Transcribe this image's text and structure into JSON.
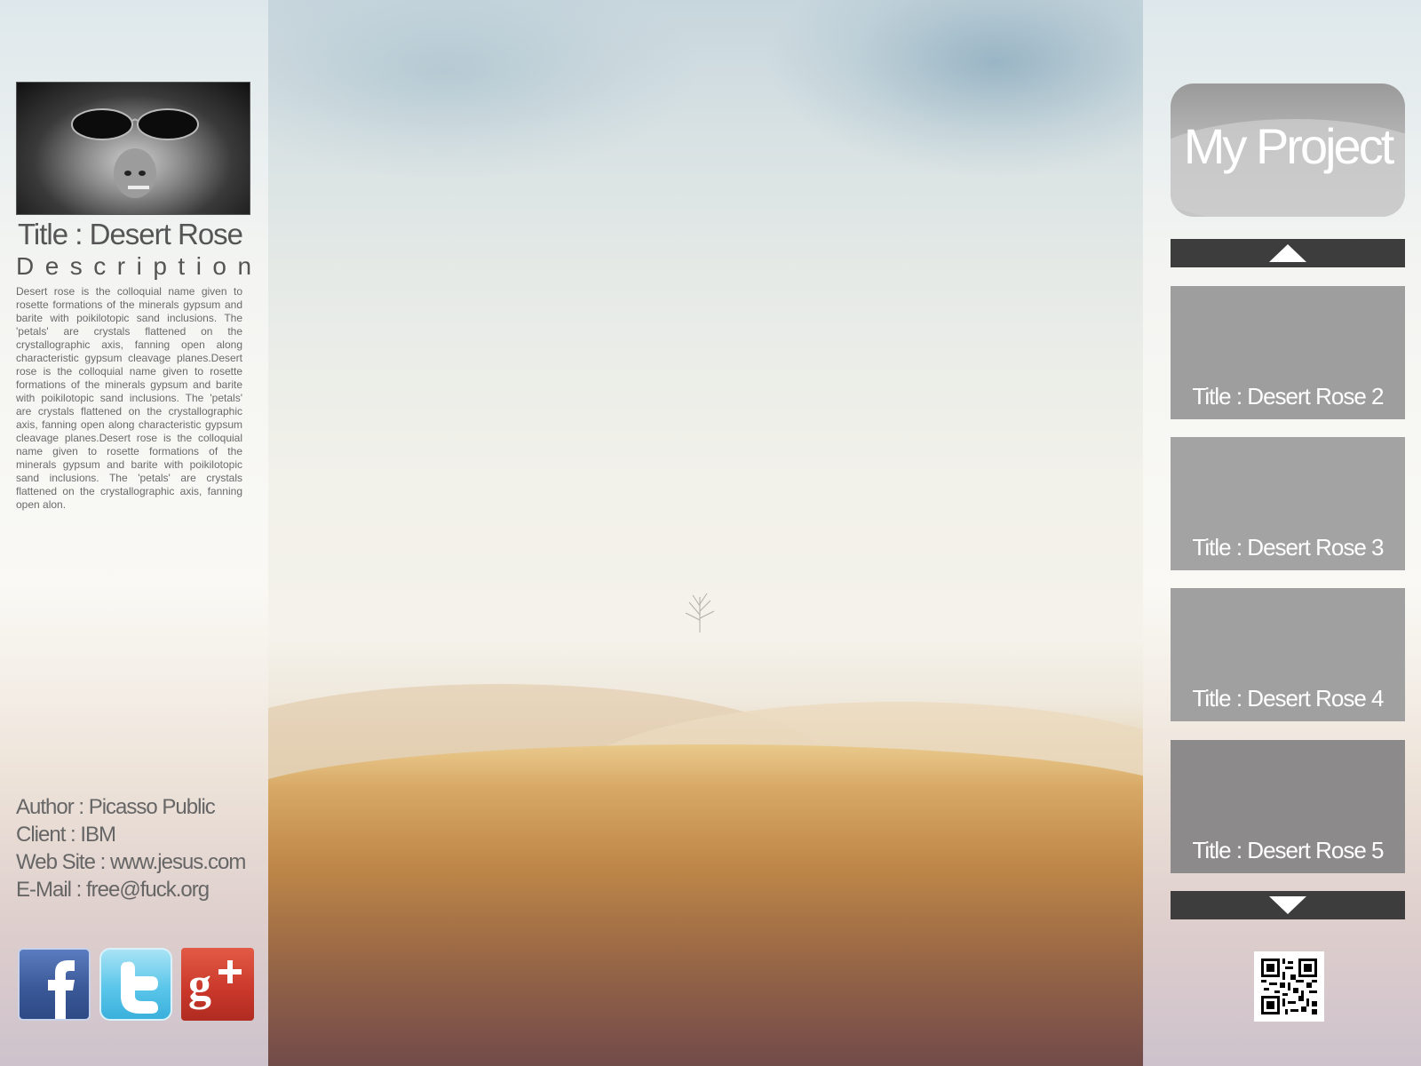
{
  "project": {
    "title": "My Project"
  },
  "detail": {
    "title": "Title : Desert Rose",
    "description_heading": "Description",
    "description_text": "Desert rose is the colloquial name given to rosette formations of the minerals gypsum and barite with poikilotopic sand inclusions. The 'petals' are crystals flattened on the crystallographic axis, fanning open along characteristic gypsum cleavage planes.Desert rose is the colloquial name given to rosette formations of the minerals gypsum and barite with poikilotopic sand inclusions. The 'petals' are crystals flattened on the crystallographic axis, fanning open along characteristic gypsum cleavage planes.Desert rose is the colloquial name given to rosette formations of the minerals gypsum and barite with poikilotopic sand inclusions. The 'petals' are crystals flattened on the crystallographic axis, fanning open alon."
  },
  "meta": {
    "author": "Author : Picasso Public",
    "client": "Client : IBM",
    "website": "Web Site : www.jesus.com",
    "email": "E-Mail : free@fuck.org"
  },
  "thumbnails": [
    {
      "label": "Title : Desert Rose 2",
      "color": "#9e9e9e"
    },
    {
      "label": "Title : Desert Rose 3",
      "color": "#a3a3a3"
    },
    {
      "label": "Title : Desert Rose 4",
      "color": "#a0a0a0"
    },
    {
      "label": "Title : Desert Rose 5",
      "color": "#8c8a8b"
    }
  ],
  "social": [
    {
      "icon": "facebook-icon"
    },
    {
      "icon": "twitter-icon"
    },
    {
      "icon": "google-plus-icon"
    }
  ],
  "colors": {
    "nav_bar": "#3d3d3d",
    "facebook": "#3b5998",
    "twitter": "#5bc6ea",
    "google_plus": "#c9372a"
  }
}
